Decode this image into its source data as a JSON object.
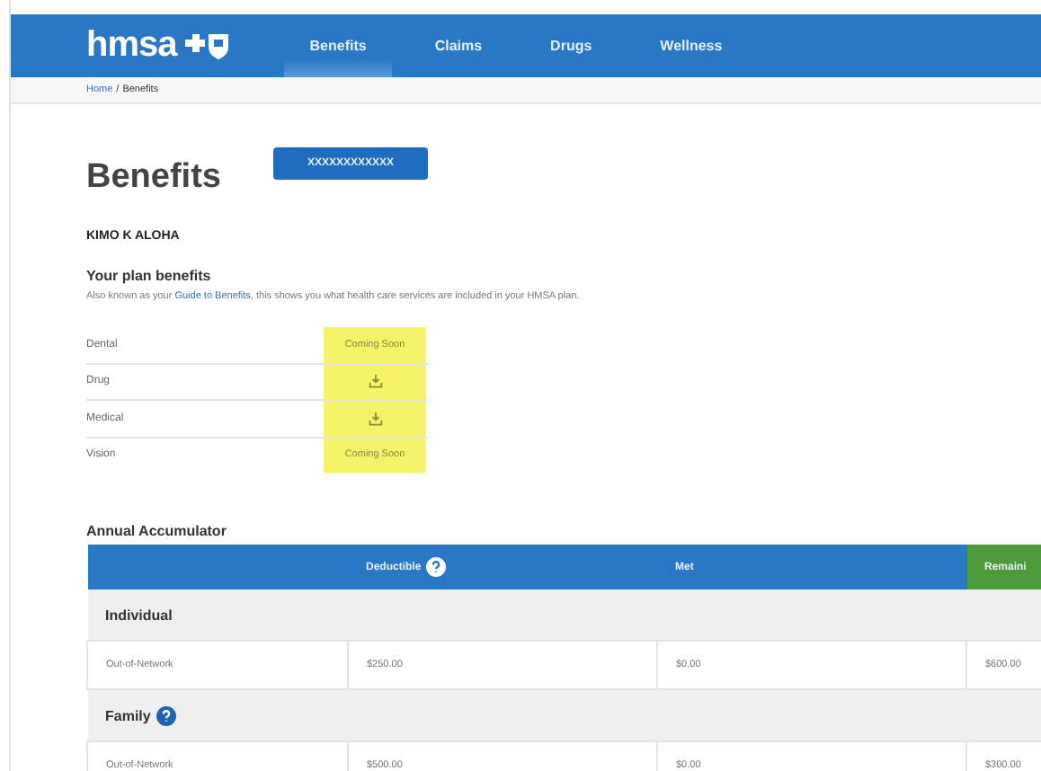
{
  "nav": {
    "logo": "hmsa",
    "tabs": [
      {
        "label": "Benefits",
        "selected": true
      },
      {
        "label": "Claims",
        "selected": false
      },
      {
        "label": "Drugs",
        "selected": false
      },
      {
        "label": "Wellness",
        "selected": false
      }
    ]
  },
  "breadcrumb": {
    "items": [
      "Home",
      "Benefits"
    ],
    "separator": "/"
  },
  "page": {
    "title": "Benefits",
    "member_button": "XXXXXXXXXXXX",
    "member_name": "KIMO K ALOHA"
  },
  "plan": {
    "heading": "Your plan benefits",
    "description_before": "Also known as your ",
    "link": "Guide to Benefits",
    "description_after": ", this shows you what health care services are included in your HMSA plan.",
    "items": [
      {
        "label": "Dental",
        "kind": "status",
        "status": "Coming Soon"
      },
      {
        "label": "Drug",
        "kind": "download"
      },
      {
        "label": "Medical",
        "kind": "download"
      },
      {
        "label": "Vision",
        "kind": "status",
        "status": "Coming Soon"
      }
    ]
  },
  "accumulator": {
    "title": "Annual Accumulator",
    "columns": [
      {
        "label": "Deductible",
        "help": true,
        "kind": "blue"
      },
      {
        "label": "Met",
        "help": false,
        "kind": "blue"
      },
      {
        "label": "Remaini",
        "help": false,
        "kind": "green"
      }
    ],
    "groups": [
      {
        "name": "Individual",
        "help": false,
        "rows": [
          {
            "label": "Out-of-Network",
            "cells": [
              "$250.00",
              "$0.00",
              "$600.00"
            ]
          }
        ]
      },
      {
        "name": "Family",
        "help": true,
        "rows": [
          {
            "label": "Out-of-Network",
            "cells": [
              "$500.00",
              "$0.00",
              "$300.00"
            ]
          }
        ]
      }
    ]
  }
}
